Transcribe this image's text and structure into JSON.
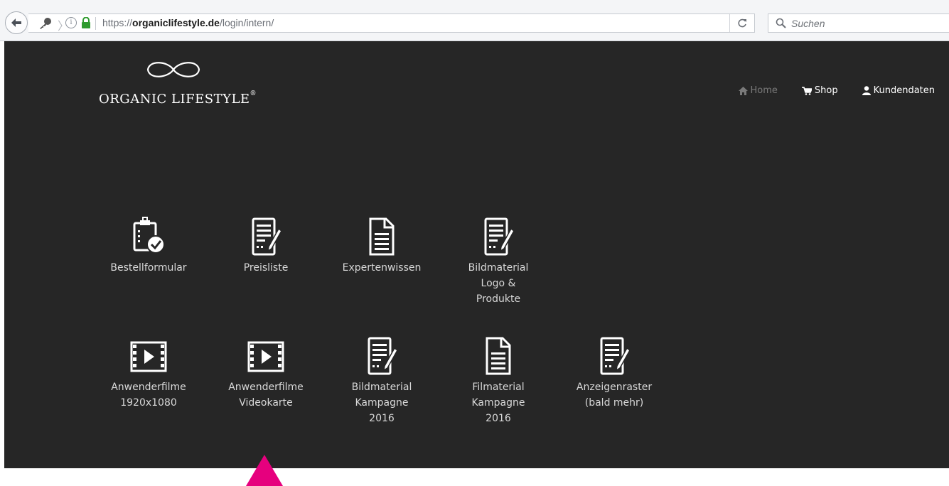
{
  "browser": {
    "url_prefix": "https://",
    "url_domain": "organiclifestyle.de",
    "url_path": "/login/intern/",
    "search_placeholder": "Suchen",
    "icons": [
      "back-arrow-icon",
      "key-icon",
      "info-icon",
      "lock-icon",
      "reload-icon",
      "search-icon"
    ]
  },
  "site": {
    "logo_text": "ORGANIC LIFESTYLE",
    "logo_reg": "®",
    "nav": [
      {
        "label": "Home",
        "icon": "home-icon",
        "active": false
      },
      {
        "label": "Shop",
        "icon": "cart-icon",
        "active": true
      },
      {
        "label": "Kundendaten",
        "icon": "user-icon",
        "active": true
      }
    ]
  },
  "tiles_row1": [
    {
      "label": "Bestellformular",
      "icon": "clipboard-check-icon"
    },
    {
      "label": "Preisliste",
      "icon": "document-edit-icon"
    },
    {
      "label": "Expertenwissen",
      "icon": "document-icon"
    },
    {
      "label": "Bildmaterial\nLogo &\nProdukte",
      "icon": "document-edit-icon"
    }
  ],
  "tiles_row2": [
    {
      "label": "Anwenderfilme\n1920x1080",
      "icon": "film-icon"
    },
    {
      "label": "Anwenderfilme\nVideokarte",
      "icon": "film-icon"
    },
    {
      "label": "Bildmaterial\nKampagne\n2016",
      "icon": "document-edit-icon"
    },
    {
      "label": "Filmaterial\nKampagne\n2016",
      "icon": "document-icon"
    },
    {
      "label": "Anzeigenraster\n(bald mehr)",
      "icon": "document-edit-icon"
    }
  ],
  "colors": {
    "page_bg": "#262626",
    "annotation_arrow": "#e6007e"
  }
}
